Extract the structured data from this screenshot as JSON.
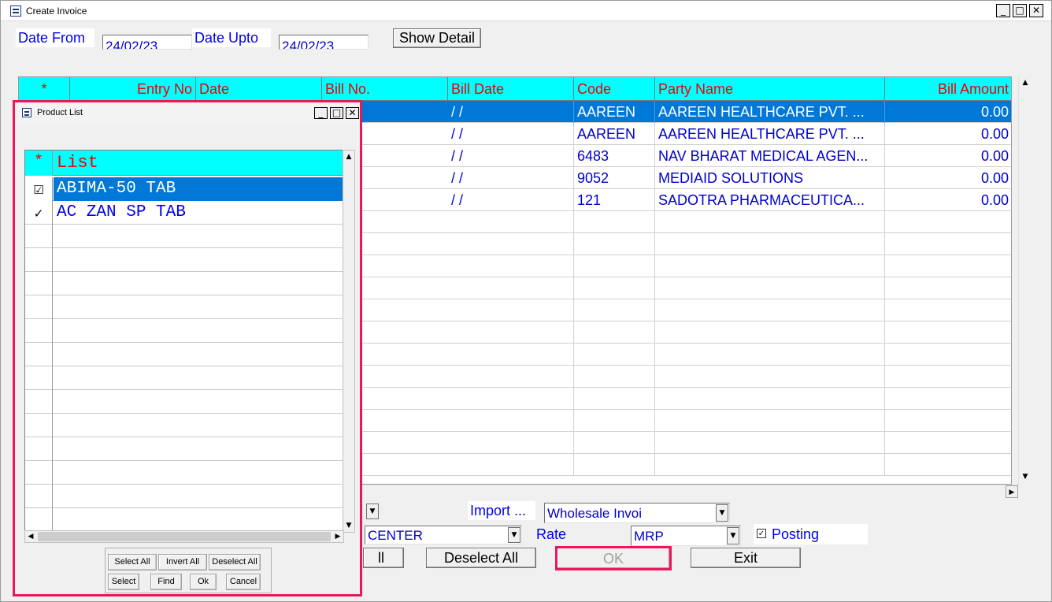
{
  "main_window": {
    "title": "Create Invoice",
    "minimize": "_",
    "maximize": "□",
    "close": "✕"
  },
  "filters": {
    "date_from_label": "Date From",
    "date_from_value": "24/02/23",
    "date_upto_label": "Date Upto",
    "date_upto_value": "24/02/23",
    "show_detail_button": "Show Detail"
  },
  "bills_grid": {
    "columns": [
      "*",
      "Entry No",
      "Date",
      "Bill No.",
      "Bill Date",
      "Code",
      "Party Name",
      "Bill Amount"
    ],
    "rows": [
      {
        "bill_date": " /  /",
        "code": "AAREEN",
        "party_name": "AAREEN HEALTHCARE PVT. ...",
        "bill_amount": "0.00"
      },
      {
        "bill_date": " /  /",
        "code": "AAREEN",
        "party_name": "AAREEN HEALTHCARE PVT. ...",
        "bill_amount": "0.00"
      },
      {
        "bill_date": " /  /",
        "code": "6483",
        "party_name": "NAV BHARAT MEDICAL AGEN...",
        "bill_amount": "0.00"
      },
      {
        "bill_date": " /  /",
        "code": "9052",
        "party_name": "MEDIAID SOLUTIONS",
        "bill_amount": "0.00"
      },
      {
        "bill_date": " /  /",
        "code": "121",
        "party_name": "SADOTRA PHARMACEUTICA...",
        "bill_amount": "0.00"
      }
    ]
  },
  "bottom": {
    "import_label": "Import ...",
    "invoice_type_value": "Wholesale Invoi",
    "center_value": "CENTER",
    "rate_label": "Rate",
    "rate_value": "MRP",
    "posting_label": "Posting",
    "posting_checked": true,
    "select_all_partial": "ll",
    "deselect_all_button": "Deselect All",
    "ok_button": "OK",
    "exit_button": "Exit"
  },
  "product_list": {
    "title": "Product List",
    "header_star": "*",
    "header_list": "List",
    "items": [
      {
        "check": "☑",
        "name": "ABIMA-50 TAB",
        "selected": true
      },
      {
        "check": "✓",
        "name": "AC ZAN SP TAB",
        "selected": false
      }
    ],
    "buttons": {
      "select_all": "Select All",
      "invert_all": "Invert All",
      "deselect_all": "Deselect All",
      "select": "Select",
      "find": "Find",
      "ok": "Ok",
      "cancel": "Cancel"
    }
  },
  "colors": {
    "header_bg": "#00ffff",
    "header_text": "#ee0000",
    "selection": "#0078d7",
    "label_text": "#0000ee",
    "highlight_border": "#e8185a"
  }
}
